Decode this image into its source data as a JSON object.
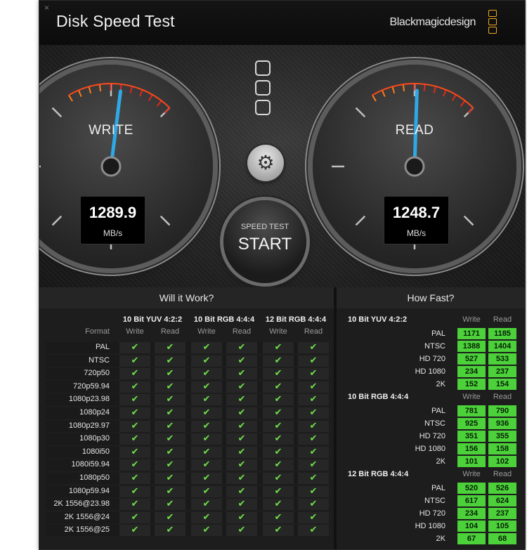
{
  "window": {
    "title": "Disk Speed Test",
    "brand": "Blackmagicdesign",
    "close_glyph": "×"
  },
  "gauges": {
    "write": {
      "label": "WRITE",
      "value": "1289.9",
      "unit": "MB/s",
      "needle_fraction": 0.86
    },
    "read": {
      "label": "READ",
      "value": "1248.7",
      "unit": "MB/s",
      "needle_fraction": 0.84
    }
  },
  "controls": {
    "settings_icon": "gear-icon",
    "start_small": "SPEED TEST",
    "start_big": "START"
  },
  "will_it_work": {
    "title": "Will it Work?",
    "format_label": "Format",
    "groups": [
      "10 Bit YUV 4:2:2",
      "10 Bit RGB 4:4:4",
      "12 Bit RGB 4:4:4"
    ],
    "columns": [
      "Write",
      "Read"
    ],
    "check_glyph": "✔",
    "formats": [
      "PAL",
      "NTSC",
      "720p50",
      "720p59.94",
      "1080p23.98",
      "1080p24",
      "1080p29.97",
      "1080p30",
      "1080i50",
      "1080i59.94",
      "1080p50",
      "1080p59.94",
      "2K 1556@23.98",
      "2K 1556@24",
      "2K 1556@25"
    ]
  },
  "how_fast": {
    "title": "How Fast?",
    "columns": [
      "Write",
      "Read"
    ],
    "groups": [
      {
        "name": "10 Bit YUV 4:2:2",
        "rows": [
          {
            "label": "PAL",
            "write": "1171",
            "read": "1185"
          },
          {
            "label": "NTSC",
            "write": "1388",
            "read": "1404"
          },
          {
            "label": "HD 720",
            "write": "527",
            "read": "533"
          },
          {
            "label": "HD 1080",
            "write": "234",
            "read": "237"
          },
          {
            "label": "2K",
            "write": "152",
            "read": "154"
          }
        ]
      },
      {
        "name": "10 Bit RGB 4:4:4",
        "rows": [
          {
            "label": "PAL",
            "write": "781",
            "read": "790"
          },
          {
            "label": "NTSC",
            "write": "925",
            "read": "936"
          },
          {
            "label": "HD 720",
            "write": "351",
            "read": "355"
          },
          {
            "label": "HD 1080",
            "write": "156",
            "read": "158"
          },
          {
            "label": "2K",
            "write": "101",
            "read": "102"
          }
        ]
      },
      {
        "name": "12 Bit RGB 4:4:4",
        "rows": [
          {
            "label": "PAL",
            "write": "520",
            "read": "526"
          },
          {
            "label": "NTSC",
            "write": "617",
            "read": "624"
          },
          {
            "label": "HD 720",
            "write": "234",
            "read": "237"
          },
          {
            "label": "HD 1080",
            "write": "104",
            "read": "105"
          },
          {
            "label": "2K",
            "write": "67",
            "read": "68"
          }
        ]
      }
    ]
  }
}
